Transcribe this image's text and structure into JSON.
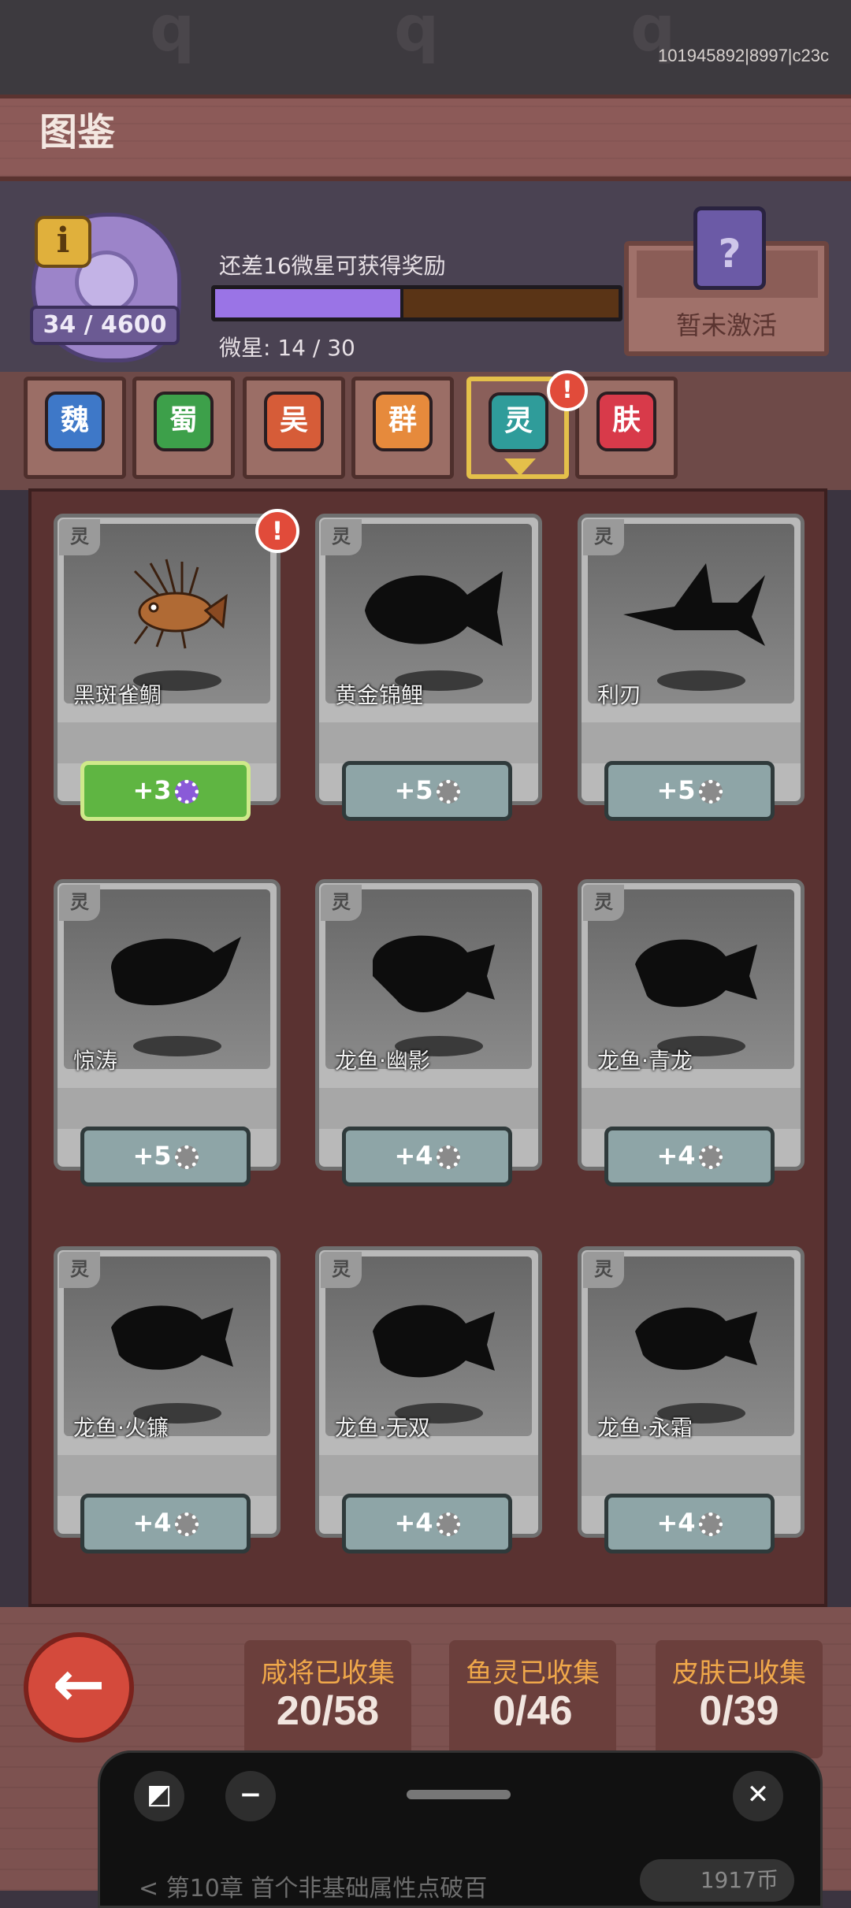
{
  "build_id": "101945892|8997|c23c",
  "title": "图鉴",
  "crest": {
    "progress_text": "34 / 4600",
    "info_icon": "i"
  },
  "reward": {
    "text": "还差16微星可获得奖励",
    "progress": 0.4667,
    "star_label": "微星: 14 / 30"
  },
  "locked": {
    "label": "暂未激活",
    "icon": "chest-question-icon"
  },
  "tabs": [
    {
      "label": "魏",
      "color": "#3e78c8"
    },
    {
      "label": "蜀",
      "color": "#3da04a"
    },
    {
      "label": "吴",
      "color": "#d65c38"
    },
    {
      "label": "群",
      "color": "#e68a3c"
    },
    {
      "label": "灵",
      "color": "#2f9c9a"
    },
    {
      "label": "肤",
      "color": "#d83a4a"
    }
  ],
  "alert_mark": "!",
  "cards": [
    {
      "tag": "灵",
      "name": "黑斑雀鲷",
      "bonus": "+3",
      "highlight": true
    },
    {
      "tag": "灵",
      "name": "黄金锦鲤",
      "bonus": "+5",
      "highlight": false
    },
    {
      "tag": "灵",
      "name": "利刃",
      "bonus": "+5",
      "highlight": false
    },
    {
      "tag": "灵",
      "name": "惊涛",
      "bonus": "+5",
      "highlight": false
    },
    {
      "tag": "灵",
      "name": "龙鱼·幽影",
      "bonus": "+4",
      "highlight": false
    },
    {
      "tag": "灵",
      "name": "龙鱼·青龙",
      "bonus": "+4",
      "highlight": false
    },
    {
      "tag": "灵",
      "name": "龙鱼·火镰",
      "bonus": "+4",
      "highlight": false
    },
    {
      "tag": "灵",
      "name": "龙鱼·无双",
      "bonus": "+4",
      "highlight": false
    },
    {
      "tag": "灵",
      "name": "龙鱼·永霜",
      "bonus": "+4",
      "highlight": false
    }
  ],
  "stats": [
    {
      "label": "咸将已收集",
      "value": "20/58"
    },
    {
      "label": "鱼灵已收集",
      "value": "0/46"
    },
    {
      "label": "皮肤已收集",
      "value": "0/39"
    }
  ],
  "overlay": {
    "bottom_text": "< 第10章 首个非基础属性点破百",
    "coin_text": "1917币"
  }
}
